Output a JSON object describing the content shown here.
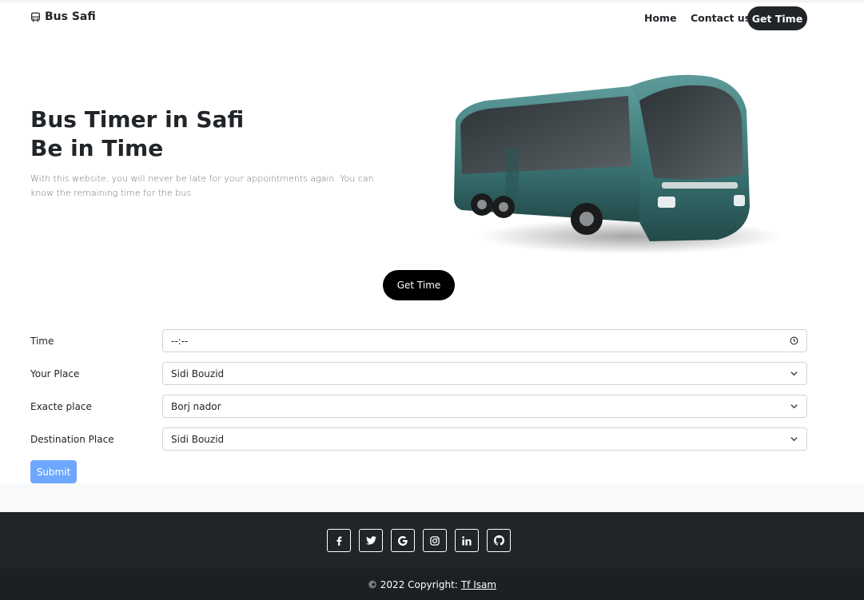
{
  "navbar": {
    "brand_icon": "bus-icon",
    "brand": "Bus Safi",
    "links": [
      "Home",
      "Contact us"
    ],
    "cta": "Get Time"
  },
  "hero": {
    "title_line1": "Bus Timer in Safi",
    "title_line2": "Be in Time",
    "text": "With this website, you will never be late for your appointments again. You can know the remaining time for the bus",
    "image": "coach-bus-image",
    "button": "Get Time"
  },
  "form": {
    "fields": [
      {
        "label": "Time",
        "value": "--:--",
        "icon": "clock-icon"
      },
      {
        "label": "Your Place",
        "value": "Sidi Bouzid",
        "icon": "chevron-down-icon"
      },
      {
        "label": "Exacte place",
        "value": "Borj nador",
        "icon": "chevron-down-icon"
      },
      {
        "label": "Destination Place",
        "value": "Sidi Bouzid",
        "icon": "chevron-down-icon"
      }
    ],
    "submit": "Submit"
  },
  "footer": {
    "socials": [
      "facebook-icon",
      "twitter-icon",
      "google-icon",
      "instagram-icon",
      "linkedin-icon",
      "github-icon"
    ],
    "copyright": "© 2022 Copyright:",
    "author": "Tf Isam"
  },
  "colors": {
    "dark": "#212529",
    "submit": "#6ea8fe",
    "bus_body": "#3e7a7a"
  }
}
